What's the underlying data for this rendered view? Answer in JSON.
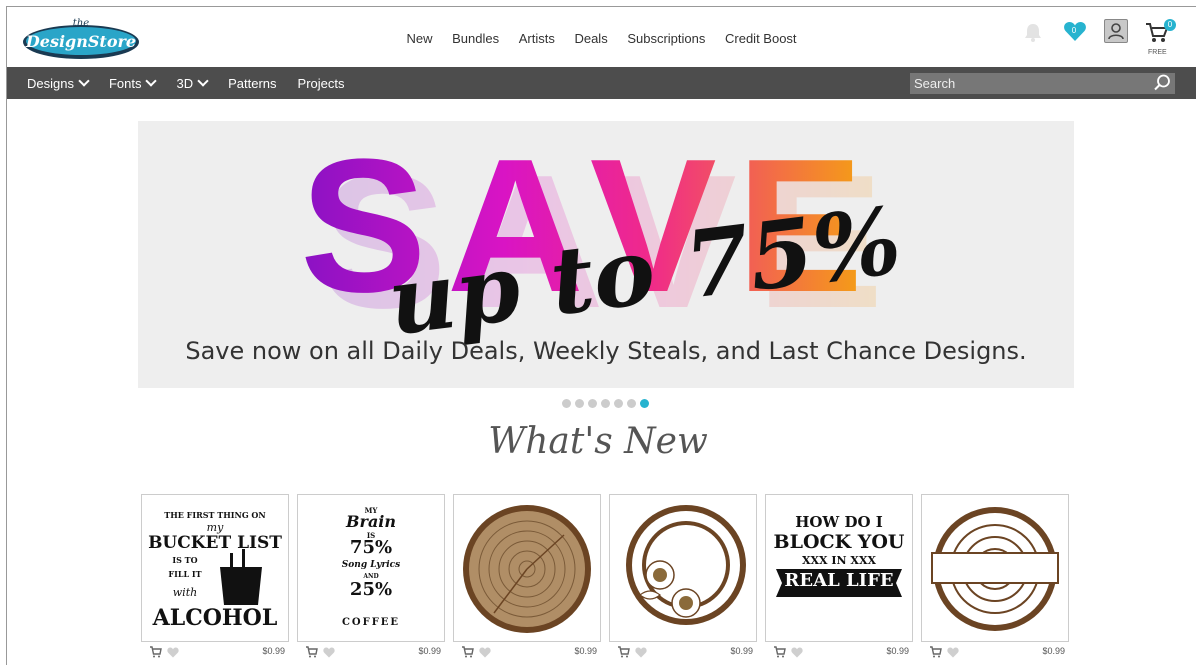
{
  "brand": {
    "logo_text_small": "the",
    "logo_text": "DesignStore"
  },
  "topnav": [
    "New",
    "Bundles",
    "Artists",
    "Deals",
    "Subscriptions",
    "Credit Boost"
  ],
  "header_icons": {
    "bell": "bell-icon",
    "wishlist_count": "0",
    "user": "user-icon",
    "cart_count": "0",
    "cart_label": "FREE"
  },
  "menu": {
    "designs": "Designs",
    "fonts": "Fonts",
    "three_d": "3D",
    "patterns": "Patterns",
    "projects": "Projects"
  },
  "search": {
    "placeholder": "Search"
  },
  "banner": {
    "headline": "SAVE",
    "script": "up to 75%",
    "subtitle": "Save now on all Daily Deals, Weekly Steals, and Last Chance Designs.",
    "slides": 7,
    "active_slide": 7
  },
  "section_title": "What's New",
  "products": [
    {
      "lines": [
        "THE FIRST THING ON",
        "my",
        "BUCKET LIST",
        "IS TO",
        "FILL IT",
        "with",
        "ALCOHOL"
      ],
      "price": "$0.99"
    },
    {
      "lines": [
        "MY",
        "Brain",
        "IS",
        "75%",
        "Song Lyrics",
        "AND",
        "25%",
        "COFFEE"
      ],
      "price": "$0.99"
    },
    {
      "lines": [],
      "price": "$0.99"
    },
    {
      "lines": [],
      "price": "$0.99"
    },
    {
      "lines": [
        "HOW DO I",
        "BLOCK YOU",
        "XXX IN XXX",
        "REAL LIFE"
      ],
      "price": "$0.99"
    },
    {
      "lines": [],
      "price": "$0.99"
    }
  ],
  "colors": {
    "accent": "#27b3cf",
    "dark_bar": "#4d4d4d",
    "wood": "#b08e66",
    "wood_dark": "#6b4423"
  }
}
